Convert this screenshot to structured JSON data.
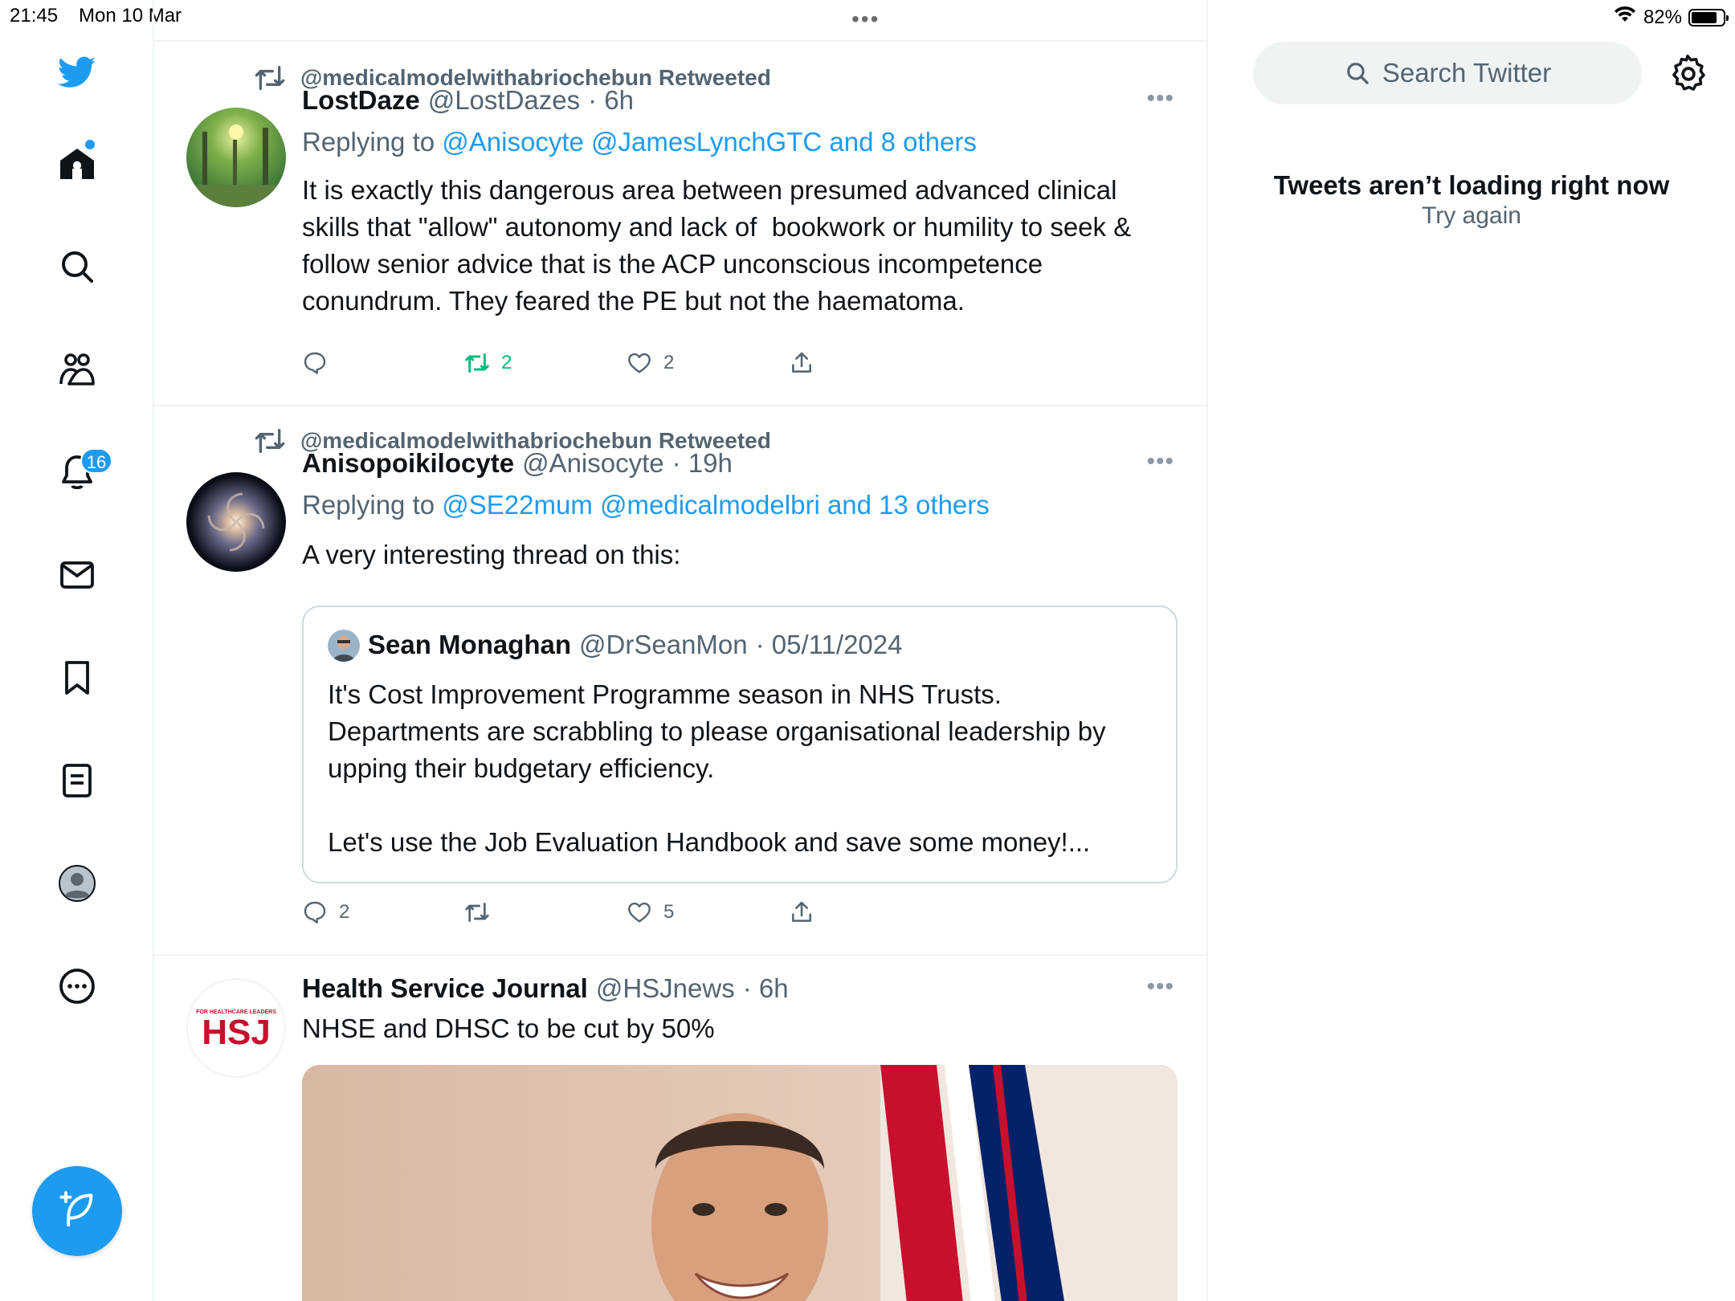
{
  "status_bar": {
    "time": "21:45",
    "date": "Mon 10 Mar",
    "battery": "82%",
    "battery_level": 0.82
  },
  "sidebar": {
    "icons": [
      "twitter-bird-icon",
      "home-icon",
      "search-icon",
      "communities-icon",
      "notifications-icon",
      "messages-icon",
      "bookmarks-icon",
      "lists-icon",
      "profile-icon",
      "more-icon"
    ],
    "notifications_badge": "16"
  },
  "feed": {
    "tweets": [
      {
        "retweeted_by": "@medicalmodelwithabriochebun Retweeted",
        "name": "LostDaze",
        "handle": "@LostDazes",
        "time": "· 6h",
        "reply_prefix": "Replying to",
        "reply_links": "@Anisocyte @JamesLynchGTC and 8 others",
        "text": "It is exactly this dangerous area between presumed advanced clinical skills that \"allow\" autonomy and lack of  bookwork or humility to seek & follow senior advice that is the ACP unconscious incompetence conundrum. They feared the PE but not the haematoma.",
        "replies": "",
        "retweets": "2",
        "likes": "2"
      },
      {
        "retweeted_by": "@medicalmodelwithabriochebun Retweeted",
        "name": "Anisopoikilocyte",
        "handle": "@Anisocyte",
        "time": "· 19h",
        "reply_prefix": "Replying to",
        "reply_links": "@SE22mum @medicalmodelbri and 13 others",
        "text": "A very interesting thread on this:",
        "quote": {
          "name": "Sean Monaghan",
          "handle": "@DrSeanMon",
          "time": "· 05/11/2024",
          "text": "It's Cost Improvement Programme season in NHS Trusts. Departments are scrabbling to please organisational leadership by upping their budgetary efficiency.\n\nLet's use the Job Evaluation Handbook and save some money!..."
        },
        "replies": "2",
        "retweets": "",
        "likes": "5"
      },
      {
        "name": "Health Service Journal",
        "handle": "@HSJnews",
        "time": "· 6h",
        "text": "NHSE and DHSC to be cut by 50%",
        "avatar_logo_text": "HSJ",
        "avatar_logo_tagline": "FOR HEALTHCARE LEADERS"
      }
    ]
  },
  "right": {
    "search_placeholder": "Search Twitter",
    "error_title": "Tweets aren’t loading right now",
    "error_retry": "Try again"
  },
  "colors": {
    "accent": "#1d9bf0",
    "retweet_green": "#00ba7c",
    "muted": "#536471",
    "border": "#eff3f4"
  }
}
